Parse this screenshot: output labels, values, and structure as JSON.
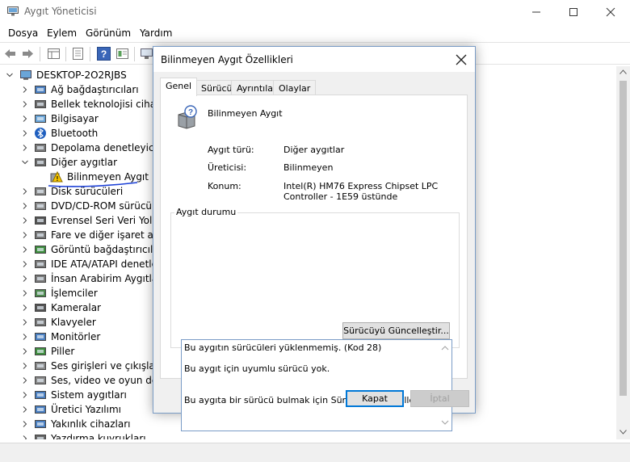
{
  "window": {
    "title": "Aygıt Yöneticisi"
  },
  "menu": {
    "items": [
      "Dosya",
      "Eylem",
      "Görünüm",
      "Yardım"
    ]
  },
  "tree": {
    "root": "DESKTOP-2O2RJBS",
    "items": [
      {
        "label": "Ağ bağdaştırıcıları",
        "icon": "network-adapter-icon",
        "expanded": false
      },
      {
        "label": "Bellek teknolojisi cihazla",
        "icon": "memory-device-icon",
        "expanded": false
      },
      {
        "label": "Bilgisayar",
        "icon": "computer-icon",
        "expanded": false
      },
      {
        "label": "Bluetooth",
        "icon": "bluetooth-icon",
        "expanded": false
      },
      {
        "label": "Depolama denetleyiciler",
        "icon": "storage-controller-icon",
        "expanded": false
      },
      {
        "label": "Diğer aygıtlar",
        "icon": "other-devices-icon",
        "expanded": true
      },
      {
        "label": "Bilinmeyen Aygıt",
        "icon": "unknown-device-warning-icon",
        "child": true
      },
      {
        "label": "Disk sürücüleri",
        "icon": "disk-drive-icon",
        "expanded": false
      },
      {
        "label": "DVD/CD-ROM sürücüle",
        "icon": "dvd-drive-icon",
        "expanded": false
      },
      {
        "label": "Evrensel Seri Veri Yolu de",
        "icon": "usb-icon",
        "expanded": false
      },
      {
        "label": "Fare ve diğer işaret aygıt",
        "icon": "mouse-icon",
        "expanded": false
      },
      {
        "label": "Görüntü bağdaştırıcıları",
        "icon": "display-adapter-icon",
        "expanded": false
      },
      {
        "label": "IDE ATA/ATAPI denetleyi",
        "icon": "ide-controller-icon",
        "expanded": false
      },
      {
        "label": "İnsan Arabirim Aygıtları",
        "icon": "hid-icon",
        "expanded": false
      },
      {
        "label": "İşlemciler",
        "icon": "processor-icon",
        "expanded": false
      },
      {
        "label": "Kameralar",
        "icon": "camera-icon",
        "expanded": false
      },
      {
        "label": "Klavyeler",
        "icon": "keyboard-icon",
        "expanded": false
      },
      {
        "label": "Monitörler",
        "icon": "monitor-icon",
        "expanded": false
      },
      {
        "label": "Piller",
        "icon": "battery-icon",
        "expanded": false
      },
      {
        "label": "Ses girişleri ve çıkışları",
        "icon": "audio-io-icon",
        "expanded": false
      },
      {
        "label": "Ses, video ve oyun dene",
        "icon": "sound-video-icon",
        "expanded": false
      },
      {
        "label": "Sistem aygıtları",
        "icon": "system-devices-icon",
        "expanded": false
      },
      {
        "label": "Üretici Yazılımı",
        "icon": "firmware-icon",
        "expanded": false
      },
      {
        "label": "Yakınlık cihazları",
        "icon": "proximity-icon",
        "expanded": false
      },
      {
        "label": "Yazdırma kuyrukları",
        "icon": "print-queue-icon",
        "expanded": false
      }
    ]
  },
  "dialog": {
    "title": "Bilinmeyen Aygıt Özellikleri",
    "tabs": [
      "Genel",
      "Sürücü",
      "Ayrıntılar",
      "Olaylar"
    ],
    "active_tab": "Genel",
    "device_name": "Bilinmeyen Aygıt",
    "properties": [
      {
        "label": "Aygıt türü:",
        "value": "Diğer aygıtlar"
      },
      {
        "label": "Üreticisi:",
        "value": "Bilinmeyen"
      },
      {
        "label": "Konum:",
        "value": "Intel(R) HM76 Express Chipset LPC Controller - 1E59 üstünde"
      }
    ],
    "status_group_title": "Aygıt durumu",
    "status_lines": [
      "Bu aygıtın sürücüleri yüklenmemiş. (Kod 28)",
      "Bu aygıt için uyumlu sürücü yok.",
      "Bu aygıta bir sürücü bulmak için Sürücüyü Güncelleştir'i tıklatın."
    ],
    "update_driver_label": "Sürücüyü Güncelleştir...",
    "ok_label": "Kapat",
    "cancel_label": "İptal"
  },
  "colors": {
    "accent": "#0078d7",
    "annotation_underline": "#1a3fd6"
  }
}
